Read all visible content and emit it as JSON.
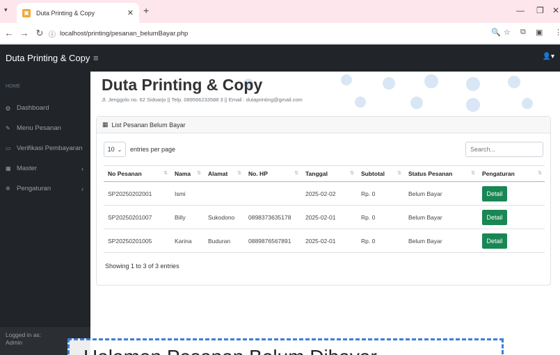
{
  "browser": {
    "tab_title": "Duta Printing & Copy",
    "url": "localhost/printing/pesanan_belumBayar.php"
  },
  "app": {
    "brand": "Duta Printing & Copy",
    "page_title": "Duta Printing & Copy",
    "subinfo": "Jl. Jenggolo no. 62 Sidoarjo || Telp. 089566233588 3 || Email : dutaprinting@gmail.com"
  },
  "sidebar": {
    "heading": "HOME",
    "items": [
      {
        "label": "Dashboard",
        "icon": "dashboard-icon"
      },
      {
        "label": "Menu Pesanan",
        "icon": "pencil-icon"
      },
      {
        "label": "Verifikasi Pembayaran",
        "icon": "money-icon"
      },
      {
        "label": "Master",
        "icon": "table-icon"
      },
      {
        "label": "Pengaturan",
        "icon": "gear-icon"
      }
    ],
    "footer_label": "Logged in as:",
    "footer_user": "Admin"
  },
  "card": {
    "header": "List Pesanan Belum Bayar",
    "page_size": "10",
    "entries_label": "entries per page",
    "search_placeholder": "Search...",
    "showing": "Showing 1 to 3 of 3 entries"
  },
  "table": {
    "columns": [
      "No Pesanan",
      "Nama",
      "Alamat",
      "No. HP",
      "Tanggal",
      "Subtotal",
      "Status Pesanan",
      "Pengaturan"
    ],
    "rows": [
      [
        "SP20250202001",
        "Ismi",
        "",
        "",
        "2025-02-02",
        "Rp. 0",
        "Belum Bayar",
        "Detail"
      ],
      [
        "SP20250201007",
        "Billy",
        "Sukodono",
        "0898373635178",
        "2025-02-01",
        "Rp. 0",
        "Belum Bayar",
        "Detail"
      ],
      [
        "SP20250201005",
        "Karina",
        "Buduran",
        "0889876567891",
        "2025-02-01",
        "Rp. 0",
        "Belum Bayar",
        "Detail"
      ]
    ]
  },
  "overlay_text": "Halaman Pesanan Belum Dibayar",
  "colors": {
    "accent": "#198754",
    "nav_bg": "#212529"
  }
}
